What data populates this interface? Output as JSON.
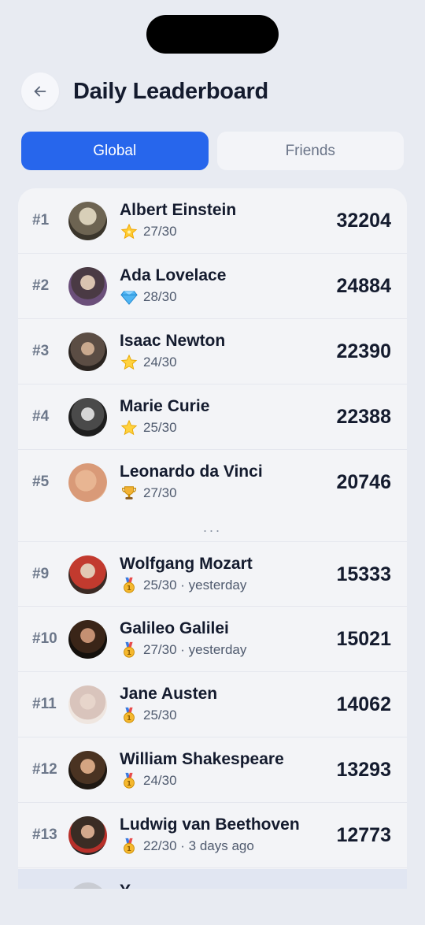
{
  "header": {
    "title": "Daily Leaderboard"
  },
  "tabs": [
    {
      "label": "Global",
      "active": true
    },
    {
      "label": "Friends",
      "active": false
    }
  ],
  "colors": {
    "accent": "#2766ec",
    "background": "#e8ebf2",
    "card": "#f3f4f7"
  },
  "entries": [
    {
      "rank": "#1",
      "name": "Albert Einstein",
      "badge": "glowing-star-icon",
      "result": "27/30",
      "score": "32204"
    },
    {
      "rank": "#2",
      "name": "Ada Lovelace",
      "badge": "gem-icon",
      "result": "28/30",
      "score": "24884"
    },
    {
      "rank": "#3",
      "name": "Isaac Newton",
      "badge": "star-icon",
      "result": "24/30",
      "score": "22390"
    },
    {
      "rank": "#4",
      "name": "Marie Curie",
      "badge": "star-icon",
      "result": "25/30",
      "score": "22388"
    },
    {
      "rank": "#5",
      "name": "Leonardo da Vinci",
      "badge": "trophy-icon",
      "result": "27/30",
      "score": "20746"
    },
    {
      "rank": "#9",
      "name": "Wolfgang Mozart",
      "badge": "medal-icon",
      "result": "25/30 · yesterday",
      "score": "15333"
    },
    {
      "rank": "#10",
      "name": "Galileo Galilei",
      "badge": "medal-icon",
      "result": "27/30 · yesterday",
      "score": "15021"
    },
    {
      "rank": "#11",
      "name": "Jane Austen",
      "badge": "medal-icon",
      "result": "25/30",
      "score": "14062"
    },
    {
      "rank": "#12",
      "name": "William Shakespeare",
      "badge": "medal-icon",
      "result": "24/30",
      "score": "13293"
    },
    {
      "rank": "#13",
      "name": "Ludwig van Beethoven",
      "badge": "medal-icon",
      "result": "22/30 · 3 days ago",
      "score": "12773"
    }
  ],
  "gap_marker": "...",
  "self_row": {
    "name": "Y"
  }
}
